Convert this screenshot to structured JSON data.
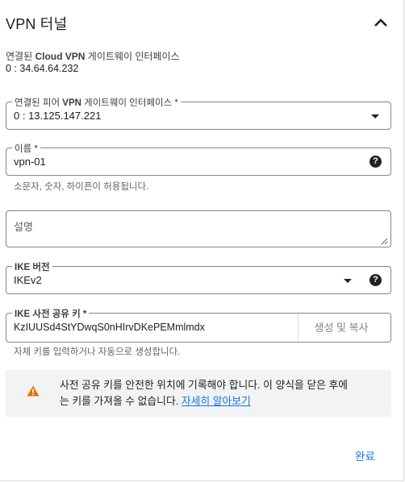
{
  "header": {
    "title": "VPN 터널",
    "toggle_icon": "chevron-up-icon"
  },
  "connected_interface": {
    "label_prefix": "연결된 ",
    "label_bold": "Cloud VPN",
    "label_suffix": " 게이트웨이 인터페이스",
    "value": "0 : 34.64.64.232"
  },
  "peer_interface": {
    "label_prefix": "연결된 피어 ",
    "label_bold": "VPN",
    "label_suffix": " 게이트웨이 인터페이스 *",
    "value": "0 : 13.125.147.221"
  },
  "name": {
    "label": "이름 *",
    "value": "vpn-01",
    "hint": "소문자, 숫자, 하이픈이 허용됩니다."
  },
  "description": {
    "placeholder": "설명",
    "value": ""
  },
  "ike_version": {
    "label": "IKE 버전",
    "value": "IKEv2"
  },
  "shared_key": {
    "label": "IKE 사전 공유 키 *",
    "value": "KzIUUSd4StYDwqS0nHIrvDKePEMmlmdx",
    "copy_button": "생성 및 복사",
    "hint": "자체 키를 입력하거나 자동으로 생성합니다."
  },
  "warning": {
    "icon": "warning-icon",
    "line1": "사전 공유 키를 안전한 위치에 기록해야 합니다. 이 양식을 닫은 후에",
    "line2": "는 키를 가져올 수 없습니다. ",
    "link": "자세히 알아보기"
  },
  "footer": {
    "done_label": "완료"
  },
  "colors": {
    "accent": "#1a73e8",
    "warning": "#e37400",
    "border": "#80868b"
  }
}
